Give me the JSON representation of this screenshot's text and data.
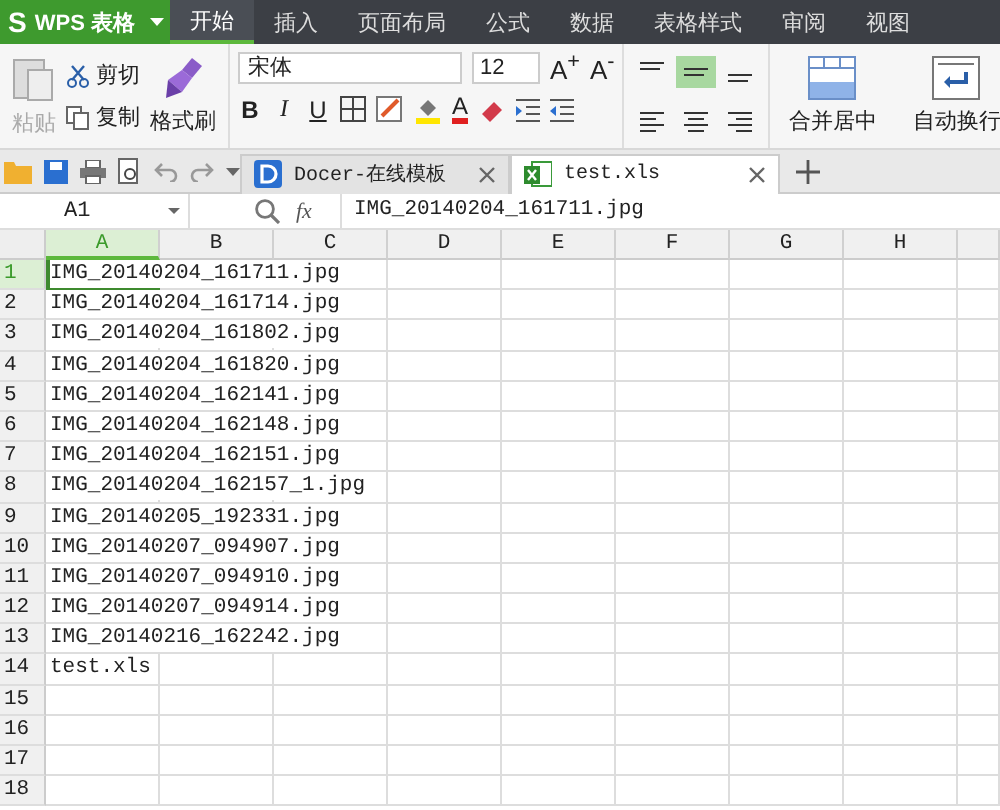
{
  "app": {
    "logo": "S",
    "name": "WPS 表格"
  },
  "menu_tabs": [
    {
      "label": "开始",
      "selected": true
    },
    {
      "label": "插入",
      "selected": false
    },
    {
      "label": "页面布局",
      "selected": false
    },
    {
      "label": "公式",
      "selected": false
    },
    {
      "label": "数据",
      "selected": false
    },
    {
      "label": "表格样式",
      "selected": false
    },
    {
      "label": "审阅",
      "selected": false
    },
    {
      "label": "视图",
      "selected": false
    }
  ],
  "ribbon": {
    "paste": {
      "label": "粘贴",
      "disabled": true
    },
    "clipboard": [
      {
        "label": "剪切",
        "kind": "cut"
      },
      {
        "label": "复制",
        "kind": "copy"
      }
    ],
    "format_painter": {
      "label": "格式刷"
    },
    "font": {
      "name": "宋体",
      "size": "12"
    },
    "size_buttons": [
      "A$^{+}$",
      "A$^{-}$"
    ],
    "style_buttons": [
      "B",
      "I",
      "U"
    ],
    "font_color": "A",
    "align_buttons": [
      {
        "kind": "top",
        "selected": false
      },
      {
        "kind": "middle",
        "selected": true
      },
      {
        "kind": "bottom",
        "selected": false
      },
      {
        "kind": "left",
        "selected": false
      },
      {
        "kind": "center",
        "selected": false
      },
      {
        "kind": "right",
        "selected": false
      }
    ],
    "merge": {
      "label": "合并居中"
    },
    "wrap": {
      "label": "自动换行"
    }
  },
  "doc_tabs": [
    {
      "label": "Docer-在线模板",
      "kind": "docer",
      "selected": false
    },
    {
      "label": "test.xls",
      "kind": "sheet",
      "selected": true
    }
  ],
  "formula_bar": {
    "cell": "A1",
    "fx": "fx",
    "value": "IMG_20140204_161711.jpg"
  },
  "sheet": {
    "columns": [
      {
        "label": "A",
        "selected": true
      },
      {
        "label": "B",
        "selected": false
      },
      {
        "label": "C",
        "selected": false
      },
      {
        "label": "D",
        "selected": false
      },
      {
        "label": "E",
        "selected": false
      },
      {
        "label": "F",
        "selected": false
      },
      {
        "label": "G",
        "selected": false
      },
      {
        "label": "H",
        "selected": false
      }
    ],
    "rows": [
      {
        "number": "1",
        "selected": true,
        "value": "IMG_20140204_161711.jpg"
      },
      {
        "number": "2",
        "selected": false,
        "value": "IMG_20140204_161714.jpg"
      },
      {
        "number": "3",
        "selected": false,
        "value": "IMG_20140204_161802.jpg"
      },
      {
        "number": "4",
        "selected": false,
        "value": "IMG_20140204_161820.jpg"
      },
      {
        "number": "5",
        "selected": false,
        "value": "IMG_20140204_162141.jpg"
      },
      {
        "number": "6",
        "selected": false,
        "value": "IMG_20140204_162148.jpg"
      },
      {
        "number": "7",
        "selected": false,
        "value": "IMG_20140204_162151.jpg"
      },
      {
        "number": "8",
        "selected": false,
        "value": "IMG_20140204_162157_1.jpg"
      },
      {
        "number": "9",
        "selected": false,
        "value": "IMG_20140205_192331.jpg"
      },
      {
        "number": "10",
        "selected": false,
        "value": "IMG_20140207_094907.jpg"
      },
      {
        "number": "11",
        "selected": false,
        "value": "IMG_20140207_094910.jpg"
      },
      {
        "number": "12",
        "selected": false,
        "value": "IMG_20140207_094914.jpg"
      },
      {
        "number": "13",
        "selected": false,
        "value": "IMG_20140216_162242.jpg"
      },
      {
        "number": "14",
        "selected": false,
        "value": "test.xls"
      },
      {
        "number": "15",
        "selected": false
      },
      {
        "number": "16",
        "selected": false
      },
      {
        "number": "17",
        "selected": false
      },
      {
        "number": "18",
        "selected": false
      }
    ]
  }
}
